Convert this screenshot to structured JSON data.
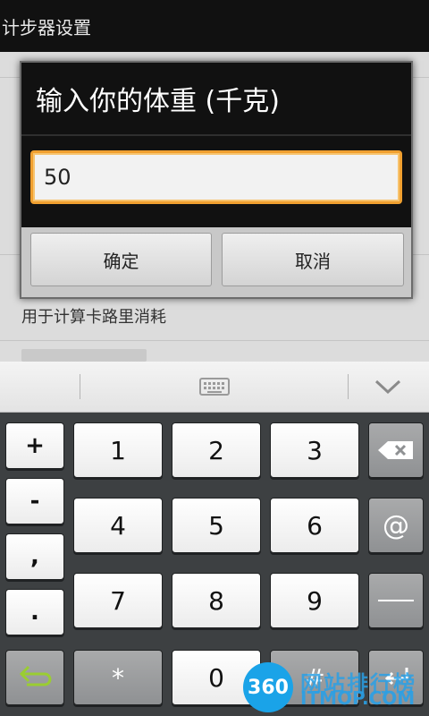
{
  "app": {
    "title": "计步器设置"
  },
  "settings": {
    "summary": "用于计算卡路里消耗"
  },
  "dialog": {
    "title": "输入你的体重 (千克)",
    "input_value": "50",
    "ok_label": "确定",
    "cancel_label": "取消"
  },
  "keyboard": {
    "toolbar_icons": [
      "keyboard-icon",
      "chevron-down-icon"
    ],
    "symbols": [
      "+",
      "-",
      ",",
      "."
    ],
    "digits": [
      "1",
      "2",
      "3",
      "4",
      "5",
      "6",
      "7",
      "8",
      "9",
      "0"
    ],
    "bottom": {
      "star": "*",
      "hash": "#"
    },
    "at": "@",
    "icons": [
      "backspace-icon",
      "space-icon",
      "back-arrow-icon",
      "enter-icon"
    ]
  },
  "watermark": {
    "logo": "360",
    "text": "网站排行榜",
    "sub": "ITMOP.COM"
  },
  "colors": {
    "input_focus": "#f0a030",
    "accent_green": "#8bc34a",
    "watermark_blue": "#1aa3e8"
  }
}
